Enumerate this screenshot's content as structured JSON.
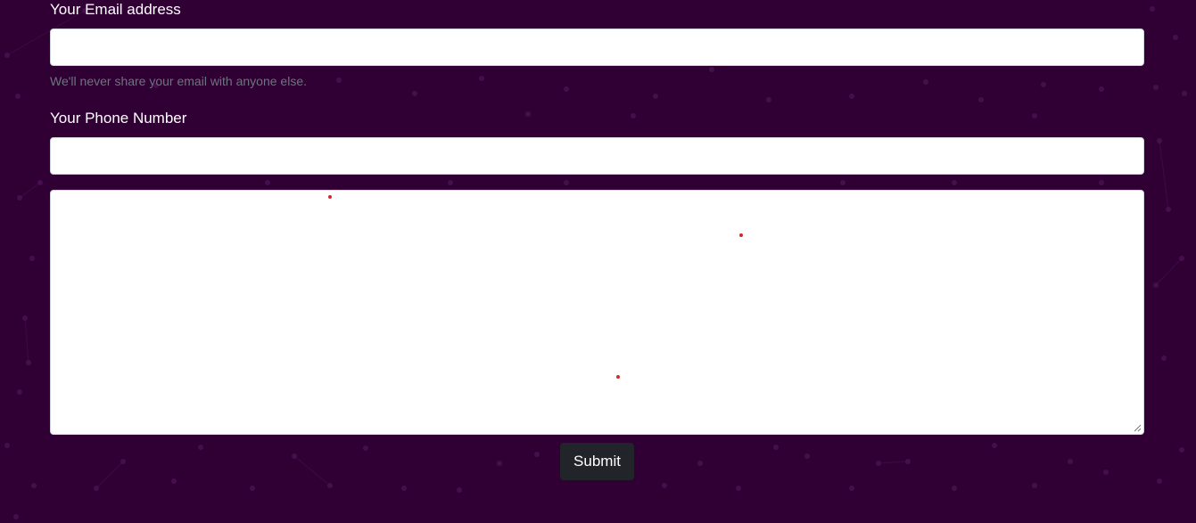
{
  "form": {
    "email_label": "Your Email address",
    "email_value": "",
    "email_help": "We'll never share your email with anyone else.",
    "phone_label": "Your Phone Number",
    "phone_value": "",
    "message_value": "",
    "submit_label": "Submit"
  },
  "colors": {
    "background": "#300035",
    "button": "#212529",
    "help_text": "#6c757d",
    "dot_red": "#d7262b"
  }
}
